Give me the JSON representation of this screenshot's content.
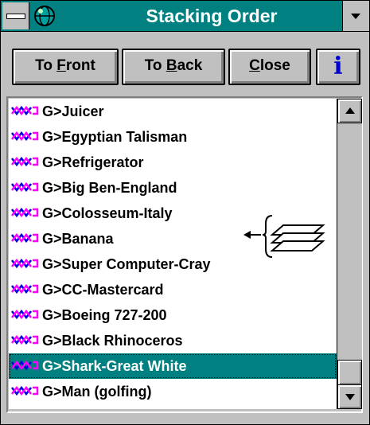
{
  "window": {
    "title": "Stacking Order",
    "icons": {
      "system_menu": "system-menu-icon",
      "app": "globe-icon",
      "dropdown": "dropdown-arrow-icon"
    }
  },
  "buttons": {
    "to_front": {
      "pre": "To ",
      "key": "F",
      "post": "ront"
    },
    "to_back": {
      "pre": "To ",
      "key": "B",
      "post": "ack"
    },
    "close": {
      "pre": "",
      "key": "C",
      "post": "lose"
    },
    "info": {
      "label": "i",
      "icon": "info-icon"
    }
  },
  "list": {
    "item_icon": "link-chain-icon",
    "selected_index": 10,
    "items": [
      "G>Juicer",
      "G>Egyptian Talisman",
      "G>Refrigerator",
      "G>Big Ben-England",
      "G>Colosseum-Italy",
      "G>Banana",
      "G>Super Computer-Cray",
      "G>CC-Mastercard",
      "G>Boeing 727-200",
      "G>Black Rhinoceros",
      "G>Shark-Great White",
      "G>Man (golfing)"
    ]
  },
  "decoration": {
    "icon": "stacked-layers-icon"
  },
  "colors": {
    "titlebar": "#008080",
    "selection": "#008080",
    "face": "#c0c0c0",
    "info_blue": "#0000d0"
  }
}
